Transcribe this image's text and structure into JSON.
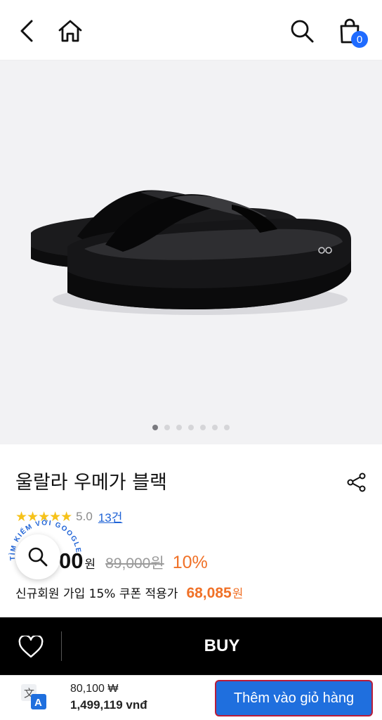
{
  "header": {
    "cart_count": "0"
  },
  "gallery": {
    "dot_count": 7,
    "active_index": 0
  },
  "product": {
    "title": "울랄라 우메가 블랙",
    "stars": "★★★★★",
    "rating": "5.0",
    "reviews": "13건",
    "price": "00",
    "price_unit": "원",
    "old_price": "89,000원",
    "discount": "10%",
    "coupon_text": "신규회원 가입 15% 쿠폰 적용가",
    "coupon_price": "68,085",
    "coupon_unit": "원"
  },
  "lens": {
    "label": "TÌM KIẾM VỚI GOOGLE"
  },
  "buybar": {
    "buy_label": "BUY"
  },
  "bottom": {
    "price_krw": "80,100 ₩",
    "price_vnd": "1,499,119 vnđ",
    "add_to_cart": "Thêm vào giỏ hàng"
  },
  "colors": {
    "accent": "#1f6fde",
    "discount": "#f07127",
    "badge": "#1f6bff"
  }
}
